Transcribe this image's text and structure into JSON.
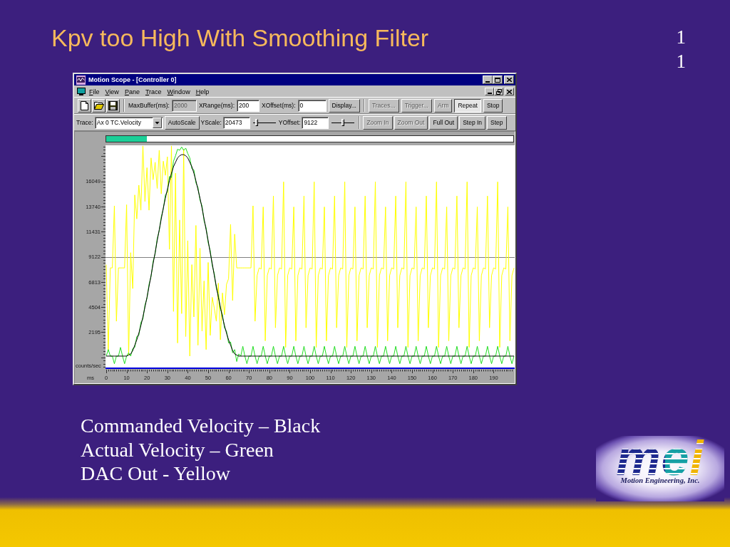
{
  "slide": {
    "title": "Kpv too High With Smoothing Filter",
    "slide_number": "11",
    "legend": [
      "Commanded Velocity – Black",
      "Actual Velocity – Green",
      "DAC Out - Yellow"
    ],
    "logo": {
      "wordmark": "mei",
      "company": "Motion Engineering, Inc."
    }
  },
  "window": {
    "title": "Motion Scope - [Controller 0]",
    "menu": [
      "File",
      "View",
      "Pane",
      "Trace",
      "Window",
      "Help"
    ],
    "toolbar_1": {
      "fields": [
        {
          "label": "MaxBuffer(ms):",
          "value": "2000",
          "disabled": true
        },
        {
          "label": "XRange(ms):",
          "value": "200",
          "disabled": false
        },
        {
          "label": "XOffset(ms):",
          "value": "0",
          "disabled": false
        }
      ],
      "display_button": {
        "label": "Display...",
        "disabled": false
      },
      "capture_buttons": [
        {
          "label": "Traces...",
          "disabled": true,
          "pressed": false
        },
        {
          "label": "Trigger...",
          "disabled": true,
          "pressed": false
        },
        {
          "label": "Arm",
          "disabled": true,
          "pressed": false
        },
        {
          "label": "Repeat",
          "disabled": false,
          "pressed": true
        },
        {
          "label": "Stop",
          "disabled": false,
          "pressed": false
        }
      ]
    },
    "toolbar_2": {
      "trace": {
        "label": "Trace:",
        "value": "Ax 0 TC.Velocity"
      },
      "autoscale_button": {
        "label": "AutoScale",
        "disabled": false
      },
      "scale_fields": [
        {
          "label": "YScale:",
          "value": "20473",
          "level": 0.15
        },
        {
          "label": "YOffset:",
          "value": "9122",
          "level": 0.48
        }
      ],
      "zoom_buttons": [
        {
          "label": "Zoom In",
          "disabled": true
        },
        {
          "label": "Zoom Out",
          "disabled": true
        },
        {
          "label": "Full Out",
          "disabled": false
        },
        {
          "label": "Step In",
          "disabled": false
        },
        {
          "label": "Step",
          "disabled": false
        }
      ]
    },
    "scope": {
      "buffer_bar": {
        "level": 0.1
      },
      "chart_data": {
        "type": "line",
        "xlabel": "ms",
        "ylabel": "counts/sec",
        "xlim": [
          0,
          200
        ],
        "ylim": [
          -1114,
          19359
        ],
        "xticks": [
          0,
          10,
          20,
          30,
          40,
          50,
          60,
          70,
          80,
          90,
          100,
          110,
          120,
          130,
          140,
          150,
          160,
          170,
          180,
          190
        ],
        "yticks": [
          2195,
          4504,
          6813,
          9122,
          11431,
          13740,
          16049
        ],
        "x": [
          0,
          1,
          2,
          3,
          4,
          5,
          6,
          7,
          8,
          9,
          10,
          11,
          12,
          13,
          14,
          15,
          16,
          17,
          18,
          19,
          20,
          21,
          22,
          23,
          24,
          25,
          26,
          27,
          28,
          29,
          30,
          31,
          32,
          33,
          34,
          35,
          36,
          37,
          38,
          39,
          40,
          41,
          42,
          43,
          44,
          45,
          46,
          47,
          48,
          49,
          50,
          51,
          52,
          53,
          54,
          55,
          56,
          57,
          58,
          59,
          60,
          61,
          62,
          63,
          64,
          65,
          66,
          67,
          68,
          69,
          70,
          71,
          72,
          73,
          74,
          75,
          76,
          77,
          78,
          79,
          80,
          81,
          82,
          83,
          84,
          85,
          86,
          87,
          88,
          89,
          90,
          91,
          92,
          93,
          94,
          95,
          96,
          97,
          98,
          99,
          100,
          101,
          102,
          103,
          104,
          105,
          106,
          107,
          108,
          109,
          110,
          111,
          112,
          113,
          114,
          115,
          116,
          117,
          118,
          119,
          120,
          121,
          122,
          123,
          124,
          125,
          126,
          127,
          128,
          129,
          130,
          131,
          132,
          133,
          134,
          135,
          136,
          137,
          138,
          139,
          140,
          141,
          142,
          143,
          144,
          145,
          146,
          147,
          148,
          149,
          150,
          151,
          152,
          153,
          154,
          155,
          156,
          157,
          158,
          159,
          160,
          161,
          162,
          163,
          164,
          165,
          166,
          167,
          168,
          169,
          170,
          171,
          172,
          173,
          174,
          175,
          176,
          177,
          178,
          179,
          180,
          181,
          182,
          183,
          184,
          185,
          186,
          187,
          188,
          189,
          190,
          191,
          192,
          193,
          194,
          195,
          196,
          197,
          198,
          199,
          200
        ],
        "series": [
          {
            "color": "#000000",
            "values": [
              0,
              0,
              0,
              0,
              0,
              0,
              0,
              0,
              0,
              0,
              0,
              100,
              200,
              500,
              1000,
              1500,
              2100,
              2800,
              3600,
              4500,
              5400,
              6400,
              7400,
              8500,
              9500,
              10600,
              11600,
              12600,
              13600,
              14500,
              15300,
              16100,
              16800,
              17400,
              17800,
              18200,
              18400,
              18500,
              18500,
              18400,
              18200,
              17800,
              17400,
              16800,
              16100,
              15300,
              14500,
              13600,
              12600,
              11600,
              10600,
              9500,
              8500,
              7400,
              6400,
              5400,
              4500,
              3600,
              2800,
              2100,
              1500,
              1000,
              500,
              200,
              100,
              0,
              0,
              0,
              0,
              0,
              0,
              0,
              0,
              0,
              0,
              0,
              0,
              0,
              0,
              0,
              0,
              0,
              0,
              0,
              0,
              0,
              0,
              0,
              0,
              0,
              0,
              0,
              0,
              0,
              0,
              0,
              0,
              0,
              0,
              0,
              0,
              0,
              0,
              0,
              0,
              0,
              0,
              0,
              0,
              0,
              0,
              0,
              0,
              0,
              0,
              0,
              0,
              0,
              0,
              0,
              0,
              0,
              0,
              0,
              0,
              0,
              0,
              0,
              0,
              0,
              0,
              0,
              0,
              0,
              0,
              0,
              0,
              0,
              0,
              0,
              0,
              0,
              0,
              0,
              0,
              0,
              0,
              0,
              0,
              0,
              0,
              0,
              0,
              0,
              0,
              0,
              0,
              0,
              0,
              0,
              0,
              0,
              0,
              0,
              0,
              0,
              0,
              0,
              0,
              0,
              0,
              0,
              0,
              0,
              0,
              0,
              0,
              0,
              0,
              0,
              0,
              0,
              0,
              0,
              0,
              0,
              0,
              0,
              0,
              0,
              0,
              0,
              0,
              0,
              0,
              0,
              0,
              0,
              0,
              0,
              0
            ]
          },
          {
            "color": "#22dd22",
            "values": [
              0,
              600,
              0,
              0,
              -700,
              0,
              0,
              800,
              0,
              -700,
              0,
              300,
              0,
              700,
              800,
              1800,
              1900,
              3100,
              3400,
              4700,
              5300,
              6600,
              7300,
              8700,
              9400,
              10800,
              11500,
              12800,
              13500,
              14800,
              15100,
              16500,
              16400,
              17900,
              18400,
              19000,
              18900,
              19200,
              18900,
              19100,
              18600,
              18200,
              17200,
              17100,
              15900,
              15500,
              14300,
              13800,
              12400,
              11800,
              10400,
              9700,
              8300,
              7600,
              6200,
              5600,
              4300,
              3800,
              2600,
              2300,
              1200,
              1300,
              300,
              600,
              -500,
              200,
              0,
              900,
              0,
              -700,
              0,
              0,
              900,
              0,
              -700,
              0,
              0,
              900,
              0,
              -700,
              0,
              0,
              900,
              0,
              -700,
              0,
              0,
              900,
              0,
              -700,
              0,
              0,
              900,
              0,
              -700,
              0,
              0,
              900,
              0,
              -700,
              0,
              0,
              900,
              0,
              -700,
              0,
              0,
              900,
              0,
              -700,
              0,
              0,
              900,
              0,
              -700,
              0,
              0,
              900,
              0,
              -700,
              0,
              0,
              900,
              0,
              -700,
              0,
              0,
              900,
              0,
              -700,
              0,
              0,
              900,
              0,
              -700,
              0,
              0,
              900,
              0,
              -700,
              0,
              0,
              900,
              0,
              -700,
              0,
              0,
              900,
              0,
              -700,
              0,
              0,
              900,
              0,
              -700,
              0,
              0,
              900,
              0,
              -700,
              0,
              0,
              900,
              0,
              -700,
              0,
              0,
              900,
              0,
              -700,
              0,
              0,
              900,
              0,
              -700,
              0,
              0,
              900,
              0,
              -700,
              0,
              0,
              900,
              0,
              -700,
              0,
              0,
              900,
              0,
              -700,
              0,
              0,
              900,
              0,
              -700,
              0,
              0,
              900,
              0,
              -700,
              0
            ]
          },
          {
            "color": "#ffff00",
            "values": [
              8400,
              500,
              8100,
              8100,
              13800,
              3200,
              8100,
              8100,
              8100,
              8100,
              13900,
              100,
              9500,
              6200,
              14800,
              12600,
              15700,
              13400,
              19300,
              14200,
              17300,
              13400,
              18200,
              16200,
              17800,
              15400,
              18900,
              14900,
              17900,
              16600,
              18300,
              9800,
              19300,
              4100,
              16800,
              1200,
              12500,
              3900,
              19000,
              1800,
              10600,
              0,
              8400,
              3600,
              12000,
              1000,
              9900,
              2300,
              6900,
              600,
              8600,
              1900,
              5400,
              4400,
              3200,
              6700,
              1500,
              5800,
              3800,
              6600,
              7100,
              12100,
              5100,
              11200,
              8100,
              8100,
              8100,
              8100,
              8100,
              8100,
              8100,
              8100,
              13800,
              3200,
              7400,
              8100,
              8000,
              13700,
              1400,
              7400,
              8100,
              8000,
              14700,
              2600,
              7400,
              8100,
              8000,
              16000,
              800,
              7400,
              8100,
              8000,
              13700,
              1400,
              7400,
              8100,
              8000,
              14700,
              2600,
              7400,
              8100,
              8000,
              16000,
              800,
              7400,
              8100,
              8000,
              13700,
              1400,
              7400,
              8100,
              8000,
              14700,
              2600,
              7400,
              8100,
              8000,
              16000,
              800,
              7400,
              8100,
              8000,
              13700,
              1400,
              7400,
              8100,
              8000,
              14700,
              2600,
              7400,
              8100,
              8000,
              16000,
              800,
              7400,
              8100,
              8000,
              13700,
              1400,
              7400,
              8100,
              8000,
              14700,
              2600,
              7400,
              8100,
              8000,
              16000,
              800,
              7400,
              8100,
              8000,
              13700,
              1400,
              7400,
              8100,
              8000,
              14700,
              2600,
              7400,
              8100,
              8000,
              16000,
              800,
              7400,
              8100,
              8000,
              13700,
              1400,
              7400,
              8100,
              8000,
              14700,
              2600,
              7400,
              8100,
              8000,
              16000,
              800,
              7400,
              8100,
              8000,
              13700,
              1400,
              7400,
              8100,
              8000,
              14700,
              2600,
              7400,
              8100,
              8000,
              16000,
              800,
              7400,
              8100,
              8000,
              13700,
              1400,
              7400,
              8100
            ]
          }
        ]
      }
    }
  }
}
